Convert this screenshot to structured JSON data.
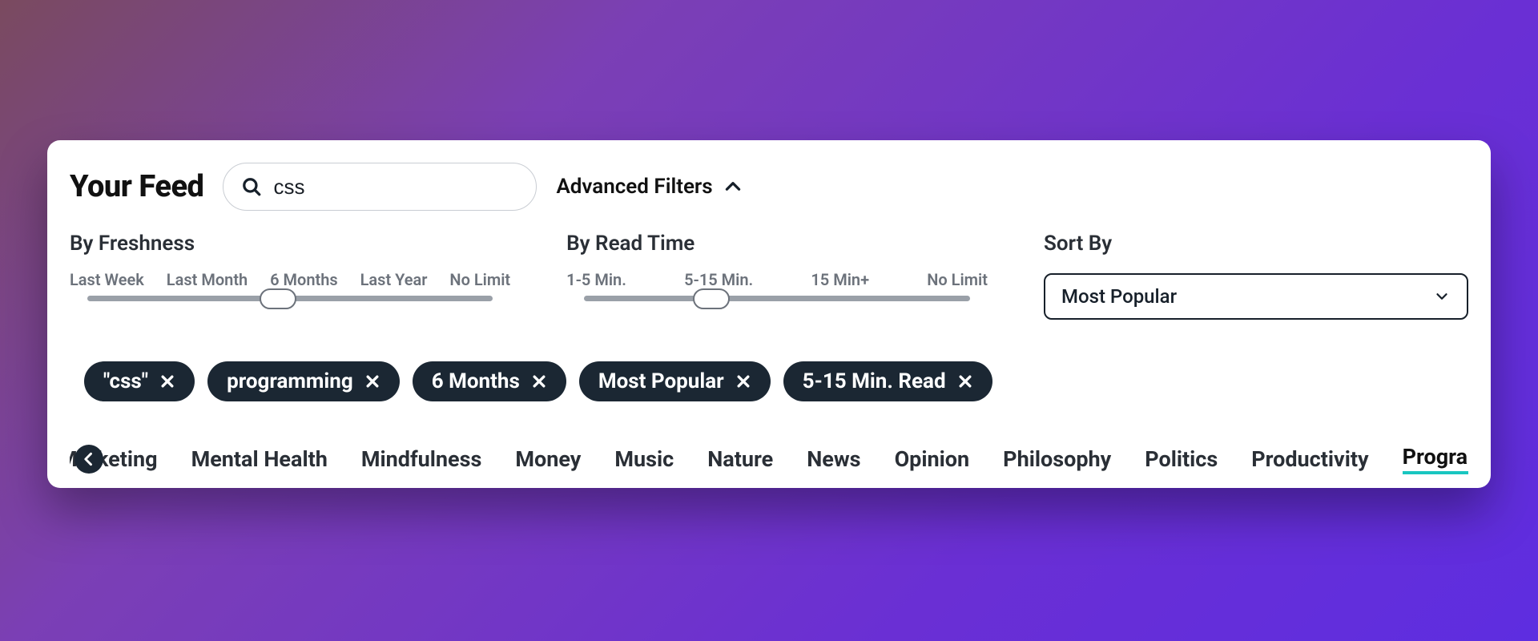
{
  "header": {
    "title": "Your Feed",
    "search_value": "css",
    "advanced_label": "Advanced Filters"
  },
  "controls": {
    "freshness": {
      "label": "By Freshness",
      "ticks": [
        "Last Week",
        "Last Month",
        "6 Months",
        "Last Year",
        "No Limit"
      ],
      "selected_index": 2,
      "thumb_percent": 47
    },
    "readtime": {
      "label": "By Read Time",
      "ticks": [
        "1-5 Min.",
        "5-15 Min.",
        "15 Min+",
        "No Limit"
      ],
      "selected_index": 1,
      "thumb_percent": 33
    },
    "sort": {
      "label": "Sort By",
      "selected": "Most Popular"
    }
  },
  "chips": [
    {
      "label": "\"css\""
    },
    {
      "label": "programming"
    },
    {
      "label": "6 Months"
    },
    {
      "label": "Most Popular"
    },
    {
      "label": "5-15 Min. Read"
    }
  ],
  "categories": {
    "items": [
      "Marketing",
      "Mental Health",
      "Mindfulness",
      "Money",
      "Music",
      "Nature",
      "News",
      "Opinion",
      "Philosophy",
      "Politics",
      "Productivity",
      "Programming"
    ],
    "active": "Programming",
    "partial_left": true
  },
  "icons": {
    "search": "search-icon",
    "chevron_up": "chevron-up-icon",
    "chevron_down": "chevron-down-icon",
    "chevron_left": "chevron-left-icon",
    "close": "close-icon"
  },
  "colors": {
    "chip_bg": "#1b2733",
    "accent": "#19c6c0",
    "text": "#17202a",
    "muted": "#6c727b"
  }
}
